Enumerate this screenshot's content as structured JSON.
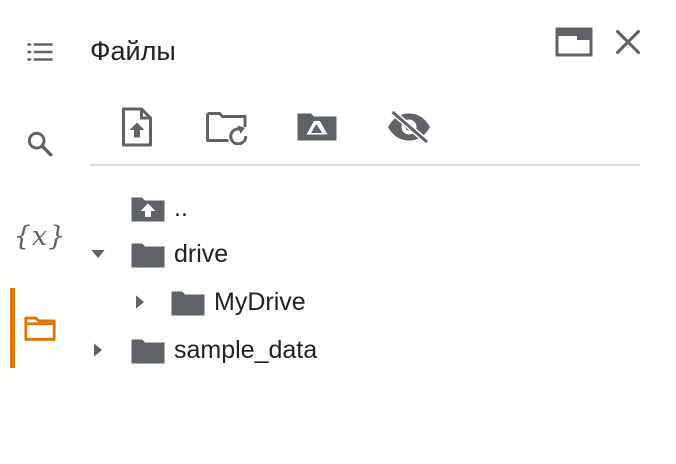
{
  "panel": {
    "title": "Файлы"
  },
  "rail": {
    "items": [
      {
        "icon": "table-of-contents-icon"
      },
      {
        "icon": "search-icon"
      },
      {
        "icon": "variables-icon",
        "glyph": "{x}"
      },
      {
        "icon": "files-icon",
        "active": true
      }
    ]
  },
  "header_actions": [
    {
      "icon": "open-in-tab-icon"
    },
    {
      "icon": "close-icon"
    }
  ],
  "toolbar": [
    {
      "icon": "upload-file-icon"
    },
    {
      "icon": "refresh-folder-icon"
    },
    {
      "icon": "mount-drive-icon"
    },
    {
      "icon": "hide-hidden-files-icon"
    }
  ],
  "tree": {
    "parent": "..",
    "items": [
      {
        "name": "drive",
        "expanded": true
      },
      {
        "name": "MyDrive",
        "expanded": false
      },
      {
        "name": "sample_data",
        "expanded": false
      }
    ]
  },
  "colors": {
    "accent": "#e37400",
    "icon": "#5f6368",
    "folder": "#5f6368",
    "divider": "#dadce0"
  }
}
